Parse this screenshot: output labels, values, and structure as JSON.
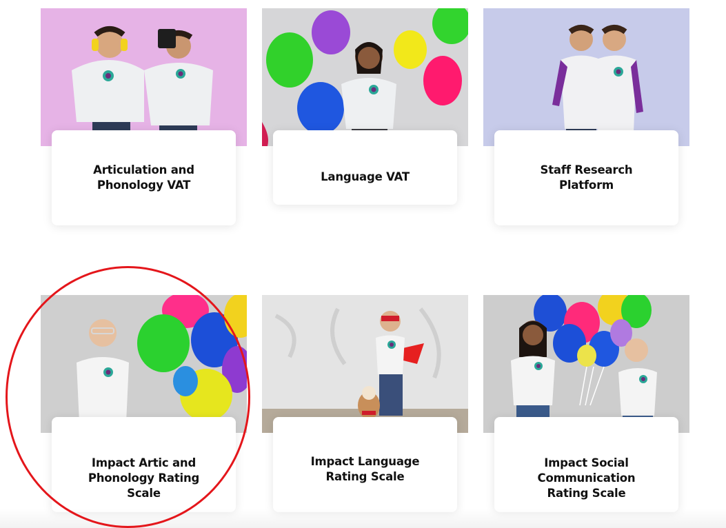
{
  "cards": [
    {
      "title": "Articulation and\nPhonology VAT"
    },
    {
      "title": "Language VAT"
    },
    {
      "title": "Staff Research\nPlatform"
    },
    {
      "title": "Impact Artic and\nPhonology Rating\nScale"
    },
    {
      "title": "Impact Language\nRating Scale"
    },
    {
      "title": "Impact Social\nCommunication\nRating Scale"
    }
  ],
  "colors": {
    "highlight_circle": "#e4161b",
    "card_text": "#111111"
  },
  "icons": [
    "photo-kids-headphones-camera",
    "photo-girl-balloons",
    "photo-boys-whisper",
    "photo-boy-balloons",
    "photo-boy-cape-dog",
    "photo-kids-balloons"
  ]
}
